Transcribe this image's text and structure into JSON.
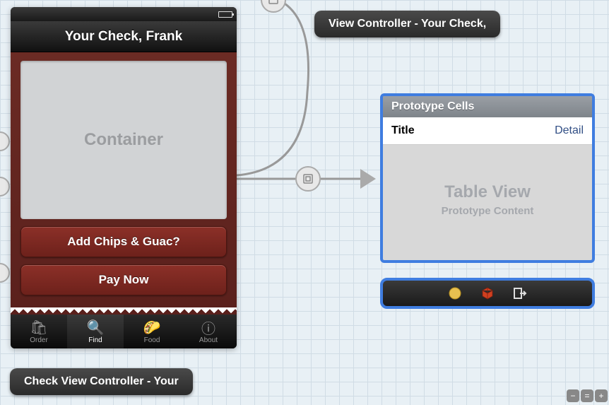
{
  "device": {
    "nav_title": "Your Check, Frank",
    "container_placeholder": "Container",
    "buttons": {
      "add_chips": "Add Chips & Guac?",
      "pay_now": "Pay Now"
    },
    "tabs": [
      {
        "icon": "order",
        "label": "Order"
      },
      {
        "icon": "find",
        "label": "Find"
      },
      {
        "icon": "food",
        "label": "Food"
      },
      {
        "icon": "about",
        "label": "About"
      }
    ],
    "selected_tab": 1
  },
  "scene_labels": {
    "bottom_left": "Check View Controller - Your",
    "top_right": "View Controller - Your Check,"
  },
  "tableview": {
    "header": "Prototype Cells",
    "cell_title": "Title",
    "cell_detail": "Detail",
    "placeholder_main": "Table View",
    "placeholder_sub": "Prototype Content"
  },
  "dock_icons": [
    "disk-icon",
    "cube-icon",
    "exit-icon"
  ],
  "zoom": [
    "minus",
    "equal",
    "plus"
  ]
}
